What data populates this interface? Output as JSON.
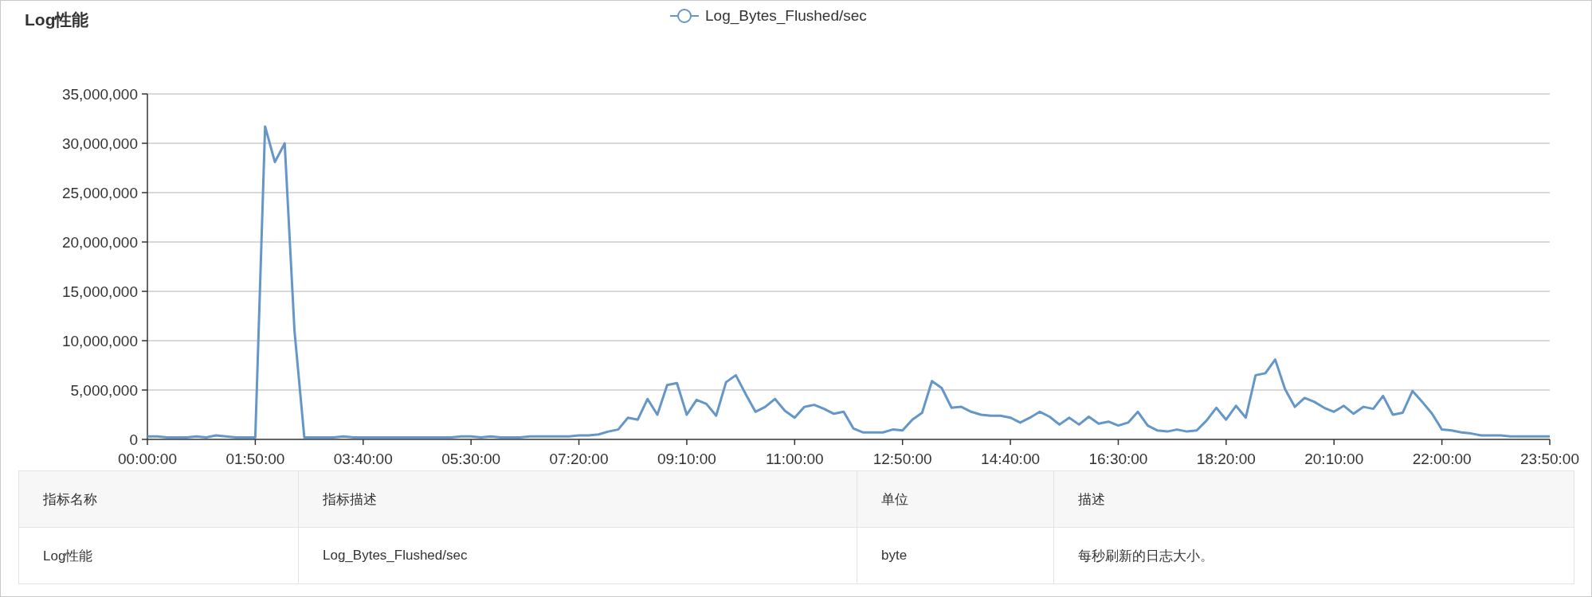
{
  "panel": {
    "title": "Log性能",
    "chart_data": {
      "type": "line",
      "grid": true,
      "x": [
        0,
        10,
        20,
        30,
        40,
        50,
        60,
        70,
        80,
        90,
        100,
        110,
        120,
        130,
        140,
        150,
        160,
        170,
        180,
        190,
        200,
        210,
        220,
        230,
        240,
        250,
        260,
        270,
        280,
        290,
        300,
        310,
        320,
        330,
        340,
        350,
        360,
        370,
        380,
        390,
        400,
        410,
        420,
        430,
        440,
        450,
        460,
        470,
        480,
        490,
        500,
        510,
        520,
        530,
        540,
        550,
        560,
        570,
        580,
        590,
        600,
        610,
        620,
        630,
        640,
        650,
        660,
        670,
        680,
        690,
        700,
        710,
        720,
        730,
        740,
        750,
        760,
        770,
        780,
        790,
        800,
        810,
        820,
        830,
        840,
        850,
        860,
        870,
        880,
        890,
        900,
        910,
        920,
        930,
        940,
        950,
        960,
        970,
        980,
        990,
        1000,
        1010,
        1020,
        1030,
        1040,
        1050,
        1060,
        1070,
        1080,
        1090,
        1100,
        1110,
        1120,
        1130,
        1140,
        1150,
        1160,
        1170,
        1180,
        1190,
        1200,
        1210,
        1220,
        1230,
        1240,
        1250,
        1260,
        1270,
        1280,
        1290,
        1300,
        1310,
        1320,
        1330,
        1340,
        1350,
        1360,
        1370,
        1380,
        1390,
        1400,
        1410,
        1420,
        1430
      ],
      "series": [
        {
          "name": "Log_Bytes_Flushed/sec",
          "color": "#6496c8",
          "values": [
            300000,
            300000,
            200000,
            200000,
            200000,
            300000,
            200000,
            400000,
            300000,
            200000,
            200000,
            200000,
            31700000,
            28100000,
            30000000,
            11000000,
            200000,
            200000,
            200000,
            200000,
            300000,
            200000,
            200000,
            200000,
            200000,
            200000,
            200000,
            200000,
            200000,
            200000,
            200000,
            200000,
            300000,
            300000,
            200000,
            300000,
            200000,
            200000,
            200000,
            300000,
            300000,
            300000,
            300000,
            300000,
            400000,
            400000,
            500000,
            800000,
            1000000,
            2200000,
            2000000,
            4100000,
            2500000,
            5500000,
            5700000,
            2500000,
            4000000,
            3600000,
            2400000,
            5800000,
            6500000,
            4600000,
            2800000,
            3300000,
            4100000,
            2900000,
            2200000,
            3300000,
            3500000,
            3100000,
            2600000,
            2800000,
            1100000,
            700000,
            700000,
            700000,
            1000000,
            900000,
            2000000,
            2700000,
            5900000,
            5200000,
            3200000,
            3300000,
            2800000,
            2500000,
            2400000,
            2400000,
            2200000,
            1700000,
            2200000,
            2800000,
            2300000,
            1500000,
            2200000,
            1500000,
            2300000,
            1600000,
            1800000,
            1400000,
            1700000,
            2800000,
            1400000,
            900000,
            800000,
            1000000,
            800000,
            900000,
            1900000,
            3200000,
            2000000,
            3400000,
            2200000,
            6500000,
            6700000,
            8100000,
            5100000,
            3300000,
            4200000,
            3800000,
            3200000,
            2800000,
            3400000,
            2600000,
            3300000,
            3100000,
            4400000,
            2500000,
            2700000,
            4900000,
            3800000,
            2600000,
            1000000,
            900000,
            700000,
            600000,
            400000,
            400000,
            400000,
            300000,
            300000,
            300000,
            300000,
            300000
          ]
        }
      ],
      "xlim": [
        0,
        1430
      ],
      "ylim": [
        0,
        35000000
      ],
      "xticks": [
        {
          "value": 0,
          "label": "00:00:00"
        },
        {
          "value": 110,
          "label": "01:50:00"
        },
        {
          "value": 220,
          "label": "03:40:00"
        },
        {
          "value": 330,
          "label": "05:30:00"
        },
        {
          "value": 440,
          "label": "07:20:00"
        },
        {
          "value": 550,
          "label": "09:10:00"
        },
        {
          "value": 660,
          "label": "11:00:00"
        },
        {
          "value": 770,
          "label": "12:50:00"
        },
        {
          "value": 880,
          "label": "14:40:00"
        },
        {
          "value": 990,
          "label": "16:30:00"
        },
        {
          "value": 1100,
          "label": "18:20:00"
        },
        {
          "value": 1210,
          "label": "20:10:00"
        },
        {
          "value": 1320,
          "label": "22:00:00"
        },
        {
          "value": 1430,
          "label": "23:50:00"
        }
      ],
      "yticks": [
        {
          "value": 0,
          "label": "0"
        },
        {
          "value": 5000000,
          "label": "5,000,000"
        },
        {
          "value": 10000000,
          "label": "10,000,000"
        },
        {
          "value": 15000000,
          "label": "15,000,000"
        },
        {
          "value": 20000000,
          "label": "20,000,000"
        },
        {
          "value": 25000000,
          "label": "25,000,000"
        },
        {
          "value": 30000000,
          "label": "30,000,000"
        },
        {
          "value": 35000000,
          "label": "35,000,000"
        }
      ]
    },
    "table": {
      "columns": [
        "指标名称",
        "指标描述",
        "单位",
        "描述"
      ],
      "rows": [
        [
          "Log性能",
          "Log_Bytes_Flushed/sec",
          "byte",
          "每秒刷新的日志大小。"
        ]
      ]
    }
  }
}
